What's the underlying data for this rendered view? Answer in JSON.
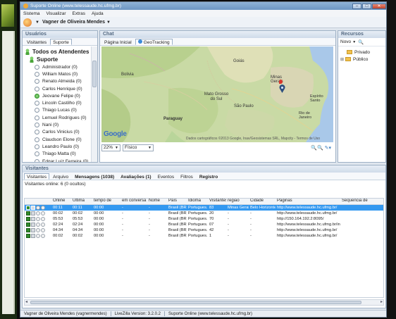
{
  "window": {
    "title": "Suporte Online (www.telessaude.hc.ufmg.br)",
    "controls": {
      "minimize": "–",
      "maximize": "□",
      "close": "✕"
    }
  },
  "menu": [
    "Sistema",
    "Visualizar",
    "Extras",
    "Ajuda"
  ],
  "user": {
    "name": "Vagner de Oliveira Mendes",
    "caret": "▼"
  },
  "usuarios": {
    "title": "Usuários",
    "tabs": [
      "Visitantes",
      "Suporte"
    ],
    "groups": [
      "Todos os Atendentes",
      "Suporte"
    ],
    "agents": [
      {
        "name": "Administrador (0)",
        "online": false
      },
      {
        "name": "William Matos (0)",
        "online": false
      },
      {
        "name": "Renato Almeida (0)",
        "online": false
      },
      {
        "name": "Carlos Henrique (0)",
        "online": false
      },
      {
        "name": "Jeovane Felipe (0)",
        "online": true
      },
      {
        "name": "Lincoln Castilho (0)",
        "online": false
      },
      {
        "name": "Thiago Lucas (0)",
        "online": false
      },
      {
        "name": "Lemuel Rodrigues (0)",
        "online": false
      },
      {
        "name": "Nani (0)",
        "online": false
      },
      {
        "name": "Carlos Vinicius (0)",
        "online": false
      },
      {
        "name": "Claudson Elone (0)",
        "online": false
      },
      {
        "name": "Leandro Paulo (0)",
        "online": false
      },
      {
        "name": "Thiago Matta (0)",
        "online": false
      },
      {
        "name": "Edgar Luiz Ferreira (0)",
        "online": false
      }
    ]
  },
  "chat": {
    "title": "Chat",
    "tabs": [
      "Página Inicial",
      "GeoTracking"
    ],
    "map": {
      "labels": [
        "Bolivia",
        "Goiás",
        "Minas Gerais",
        "Mato Grosso do Sul",
        "São Paulo",
        "Paraguay",
        "Espírito Santo",
        "Rio de Janeiro"
      ],
      "logo": "Google",
      "attribution": "Dados cartográficos ©2013 Google, Inav/Geosistemas SRL, Mapcity - Termos de Uso"
    },
    "zoom_value": "22%",
    "map_type": "Físico",
    "zoom_icons": "🔍🔍 ✎▾"
  },
  "recursos": {
    "title": "Recursos",
    "new_label": "Novo",
    "items": [
      "Privado",
      "Público"
    ]
  },
  "visitantes": {
    "title": "Visitantes",
    "tabs": [
      {
        "label": "Visitantes",
        "bold": false
      },
      {
        "label": "Arquivo",
        "bold": false
      },
      {
        "label": "Mensagens (1038)",
        "bold": true
      },
      {
        "label": "Avaliações (1)",
        "bold": true
      },
      {
        "label": "Eventos",
        "bold": false
      },
      {
        "label": "Filtros",
        "bold": false
      },
      {
        "label": "Registro",
        "bold": true
      }
    ],
    "online_text": "Visitantes online: 6 (0 ocultos)",
    "columns": [
      "",
      "Online",
      "Última",
      "tempo de",
      "em conversa",
      "Nome",
      "País",
      "Idioma",
      "Visitantes",
      "região",
      "Cidade",
      "Páginas",
      "Sequencia de"
    ],
    "rows": [
      [
        "00:11",
        "00:11",
        "00:00",
        "-",
        "-",
        "Brasil (BR)",
        "Portugues...",
        "83",
        "Minas Gerais",
        "Belo Horizonte",
        "http://www.telessaude.hc.ufmg.br/",
        ""
      ],
      [
        "00:02",
        "00:02",
        "00:00",
        "-",
        "-",
        "Brasil (BR)",
        "Portugues...",
        "20",
        "-",
        "-",
        "http://www.telessaude.hc.ufmg.br/",
        ""
      ],
      [
        "05:53",
        "05:53",
        "00:00",
        "-",
        "-",
        "Brasil (BR)",
        "Portugues...",
        "70",
        "-",
        "-",
        "http://150.164.192.2:8095/",
        ""
      ],
      [
        "02:24",
        "02:24",
        "00:00",
        "-",
        "-",
        "Brasil (BR)",
        "Portugues...",
        "07",
        "-",
        "-",
        "http://www.telessaude.hc.ufmg.br/index...",
        ""
      ],
      [
        "04:34",
        "04:34",
        "00:00",
        "-",
        "-",
        "Brasil (BR)",
        "Portugues...",
        "42",
        "-",
        "-",
        "http://www.telessaude.hc.ufmg.br/",
        ""
      ],
      [
        "00:02",
        "00:02",
        "00:00",
        "-",
        "-",
        "Brasil (BR)",
        "Portugues...",
        "1",
        "-",
        "-",
        "http://www.telessaude.hc.ufmg.br/",
        ""
      ]
    ]
  },
  "status": {
    "user": "Vagner de Oliveira Mendes (vagnermendes)",
    "version": "LiveZilla Version: 3.2.0.2",
    "server": "Suporte Online (www.telessaude.hc.ufmg.br)"
  },
  "colors": {
    "accent": "#3398f0",
    "panel_header": "#556a82",
    "online": "#3e9d34"
  }
}
